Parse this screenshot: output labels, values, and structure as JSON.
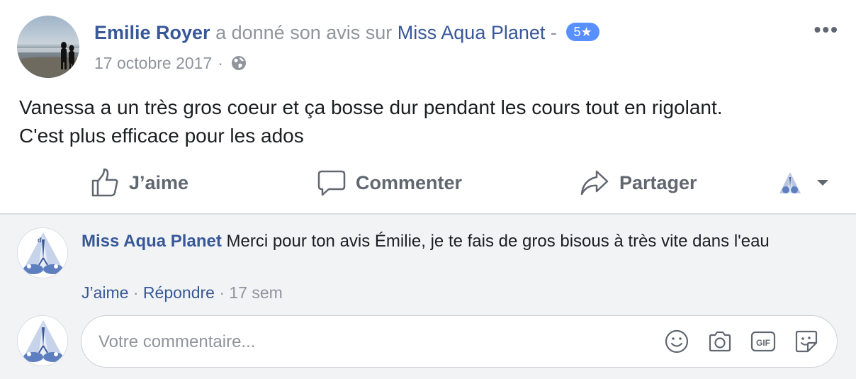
{
  "post": {
    "author": "Emilie Royer",
    "verb": "a donné son avis sur",
    "page": "Miss Aqua Planet",
    "dash": "-",
    "rating": "5★",
    "date": "17 octobre 2017",
    "date_sep": "·",
    "privacy_icon": "globe-icon",
    "more_label": "•••",
    "text_line1": "Vanessa a un très gros coeur et ça bosse dur pendant les cours tout en rigolant.",
    "text_line2": "C'est plus efficace pour les ados"
  },
  "actions": {
    "like": "J’aime",
    "comment": "Commenter",
    "share": "Partager"
  },
  "comment": {
    "author": "Miss Aqua Planet",
    "text": "Merci pour ton avis Émilie, je te fais de gros bisous à très vite dans l'eau",
    "like": "J’aime",
    "reply": "Répondre",
    "time": "17 sem",
    "sep": "·"
  },
  "composer": {
    "placeholder": "Votre commentaire...",
    "icons": [
      "emoji-icon",
      "camera-icon",
      "gif-icon",
      "sticker-icon"
    ]
  },
  "colors": {
    "link": "#385898",
    "muted": "#90949c",
    "badge": "#5890ff",
    "comment_bg": "#f2f3f5"
  }
}
